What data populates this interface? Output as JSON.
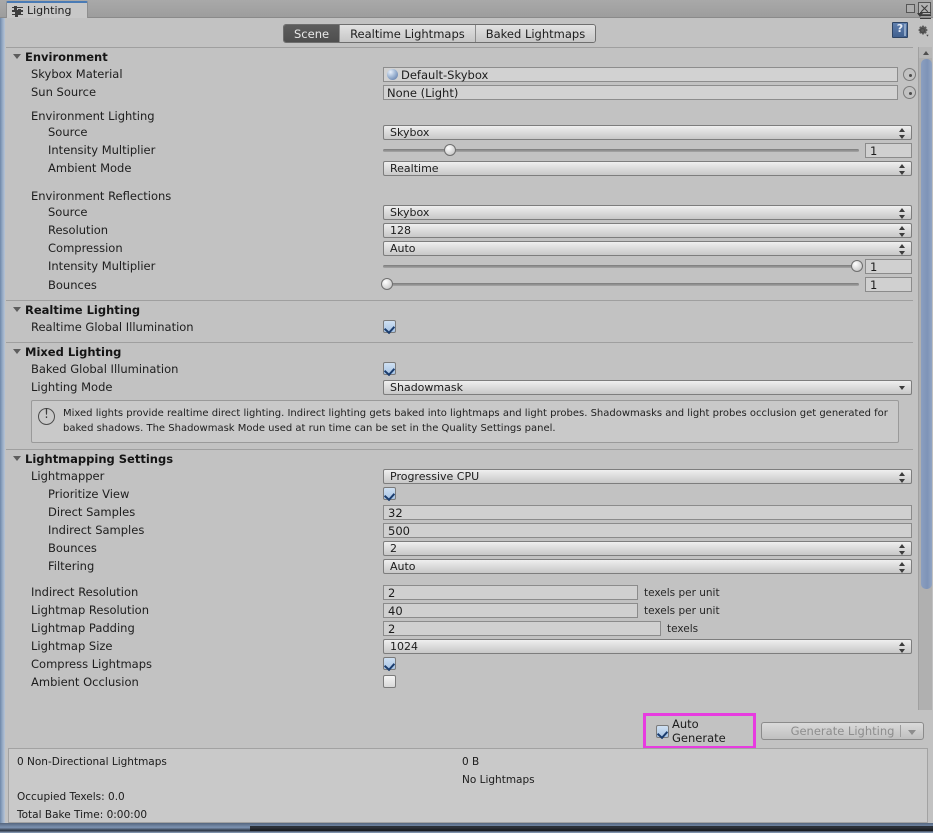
{
  "window": {
    "tab_label": "Lighting",
    "tab_icon": "lighting-settings-icon",
    "minimize_icon": "minimize-icon",
    "close_icon": "close-icon",
    "menu_icon": "window-menu-icon"
  },
  "toolbar": {
    "modes": [
      {
        "label": "Scene",
        "active": true
      },
      {
        "label": "Realtime Lightmaps",
        "active": false
      },
      {
        "label": "Baked Lightmaps",
        "active": false
      }
    ],
    "help_icon": "help-book-icon",
    "settings_icon": "gear-icon"
  },
  "sections": {
    "environment": {
      "title": "Environment",
      "skybox_material_label": "Skybox Material",
      "skybox_material_value": "Default-Skybox",
      "sun_source_label": "Sun Source",
      "sun_source_value": "None (Light)",
      "env_lighting_group": "Environment Lighting",
      "env_lighting_source_label": "Source",
      "env_lighting_source_value": "Skybox",
      "env_lighting_intensity_label": "Intensity Multiplier",
      "env_lighting_intensity_value": "1",
      "env_lighting_intensity_pct": 14,
      "ambient_mode_label": "Ambient Mode",
      "ambient_mode_value": "Realtime",
      "env_reflections_group": "Environment Reflections",
      "refl_source_label": "Source",
      "refl_source_value": "Skybox",
      "refl_resolution_label": "Resolution",
      "refl_resolution_value": "128",
      "refl_compression_label": "Compression",
      "refl_compression_value": "Auto",
      "refl_intensity_label": "Intensity Multiplier",
      "refl_intensity_value": "1",
      "refl_intensity_pct": 100,
      "refl_bounces_label": "Bounces",
      "refl_bounces_value": "1",
      "refl_bounces_pct": 0
    },
    "realtime_lighting": {
      "title": "Realtime Lighting",
      "realtime_gi_label": "Realtime Global Illumination",
      "realtime_gi_checked": true
    },
    "mixed_lighting": {
      "title": "Mixed Lighting",
      "baked_gi_label": "Baked Global Illumination",
      "baked_gi_checked": true,
      "lighting_mode_label": "Lighting Mode",
      "lighting_mode_value": "Shadowmask",
      "info_icon": "info-icon",
      "info_text": "Mixed lights provide realtime direct lighting. Indirect lighting gets baked into lightmaps and light probes. Shadowmasks and light probes occlusion get generated for baked shadows. The Shadowmask Mode used at run time can be set in the Quality Settings panel."
    },
    "lightmapping": {
      "title": "Lightmapping Settings",
      "lightmapper_label": "Lightmapper",
      "lightmapper_value": "Progressive CPU",
      "prioritize_view_label": "Prioritize View",
      "prioritize_view_checked": true,
      "direct_samples_label": "Direct Samples",
      "direct_samples_value": "32",
      "indirect_samples_label": "Indirect Samples",
      "indirect_samples_value": "500",
      "bounces_label": "Bounces",
      "bounces_value": "2",
      "filtering_label": "Filtering",
      "filtering_value": "Auto",
      "indirect_resolution_label": "Indirect Resolution",
      "indirect_resolution_value": "2",
      "indirect_resolution_unit": "texels per unit",
      "lightmap_resolution_label": "Lightmap Resolution",
      "lightmap_resolution_value": "40",
      "lightmap_resolution_unit": "texels per unit",
      "lightmap_padding_label": "Lightmap Padding",
      "lightmap_padding_value": "2",
      "lightmap_padding_unit": "texels",
      "lightmap_size_label": "Lightmap Size",
      "lightmap_size_value": "1024",
      "compress_lightmaps_label": "Compress Lightmaps",
      "compress_lightmaps_checked": true,
      "ambient_occlusion_label": "Ambient Occlusion",
      "ambient_occlusion_checked": false
    }
  },
  "generate": {
    "auto_generate_label": "Auto Generate",
    "auto_generate_checked": true,
    "generate_button_label": "Generate Lighting",
    "generate_button_enabled": false,
    "highlight_color": "#e73ce0"
  },
  "status": {
    "lightmaps_count_text": "0 Non-Directional Lightmaps",
    "size_text": "0 B",
    "no_lightmaps_text": "No Lightmaps",
    "occupied_texels_text": "Occupied Texels: 0.0",
    "total_bake_time_text": "Total Bake Time: 0:00:00"
  }
}
